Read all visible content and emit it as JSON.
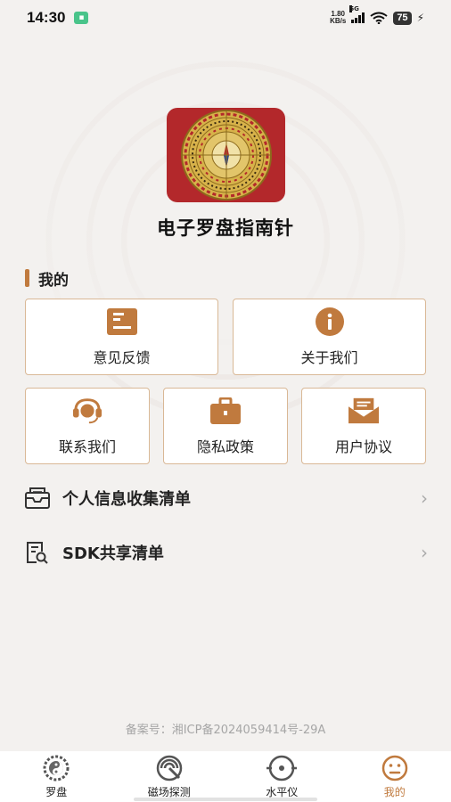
{
  "status_bar": {
    "time": "14:30",
    "net_speed_value": "1.80",
    "net_speed_unit": "KB/s",
    "network": "5G",
    "battery": "75"
  },
  "app": {
    "title": "电子罗盘指南针"
  },
  "section": {
    "title": "我的"
  },
  "cards": [
    {
      "label": "意见反馈",
      "icon": "feedback-icon"
    },
    {
      "label": "关于我们",
      "icon": "info-icon"
    },
    {
      "label": "联系我们",
      "icon": "headset-icon"
    },
    {
      "label": "隐私政策",
      "icon": "briefcase-icon"
    },
    {
      "label": "用户协议",
      "icon": "mail-open-icon"
    }
  ],
  "list": [
    {
      "label": "个人信息收集清单",
      "icon": "inbox-icon"
    },
    {
      "label": "SDK共享清单",
      "icon": "search-document-icon"
    }
  ],
  "icp": "备案号：湘ICP备2024059414号-29A",
  "tabs": [
    {
      "label": "罗盘",
      "icon": "compass-dial-icon",
      "active": false
    },
    {
      "label": "磁场探测",
      "icon": "magnetic-field-icon",
      "active": false
    },
    {
      "label": "水平仪",
      "icon": "level-icon",
      "active": false
    },
    {
      "label": "我的",
      "icon": "smiley-icon",
      "active": true
    }
  ],
  "colors": {
    "accent": "#c07a3e",
    "card_border": "#d9b896",
    "logo_bg": "#b3282b"
  }
}
